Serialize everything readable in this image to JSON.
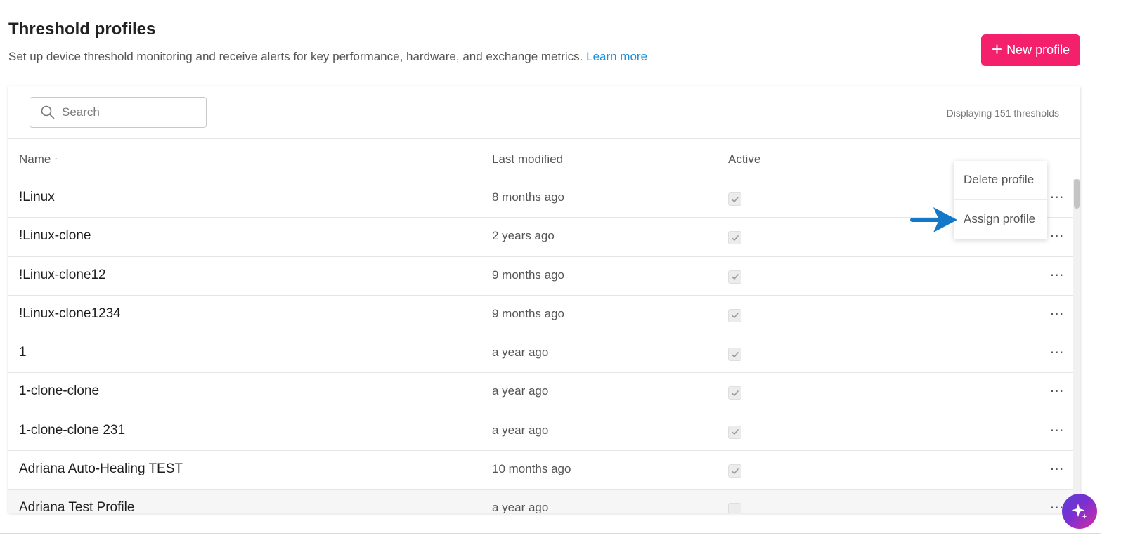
{
  "header": {
    "title": "Threshold profiles",
    "subtitle": "Set up device threshold monitoring and receive alerts for key performance, hardware, and exchange metrics.",
    "learn_more": "Learn more",
    "new_profile_label": "New profile"
  },
  "toolbar": {
    "search_placeholder": "Search",
    "display_count": "Displaying 151 thresholds"
  },
  "table": {
    "columns": {
      "name": "Name",
      "last_modified": "Last modified",
      "active": "Active"
    },
    "rows": [
      {
        "name": "!Linux",
        "last_modified": "8 months ago",
        "active": true
      },
      {
        "name": "!Linux-clone",
        "last_modified": "2 years ago",
        "active": true
      },
      {
        "name": "!Linux-clone12",
        "last_modified": "9 months ago",
        "active": true
      },
      {
        "name": "!Linux-clone1234",
        "last_modified": "9 months ago",
        "active": true
      },
      {
        "name": "1",
        "last_modified": "a year ago",
        "active": true
      },
      {
        "name": "1-clone-clone",
        "last_modified": "a year ago",
        "active": true
      },
      {
        "name": "1-clone-clone 231",
        "last_modified": "a year ago",
        "active": true
      },
      {
        "name": "Adriana Auto-Healing TEST",
        "last_modified": "10 months ago",
        "active": true
      },
      {
        "name": "Adriana Test Profile",
        "last_modified": "a year ago",
        "active": false
      }
    ]
  },
  "context_menu": {
    "items": [
      "Delete profile",
      "Assign profile"
    ]
  },
  "colors": {
    "primary": "#f4206b",
    "link": "#1b8fd8",
    "annotation_arrow": "#1478c8"
  }
}
